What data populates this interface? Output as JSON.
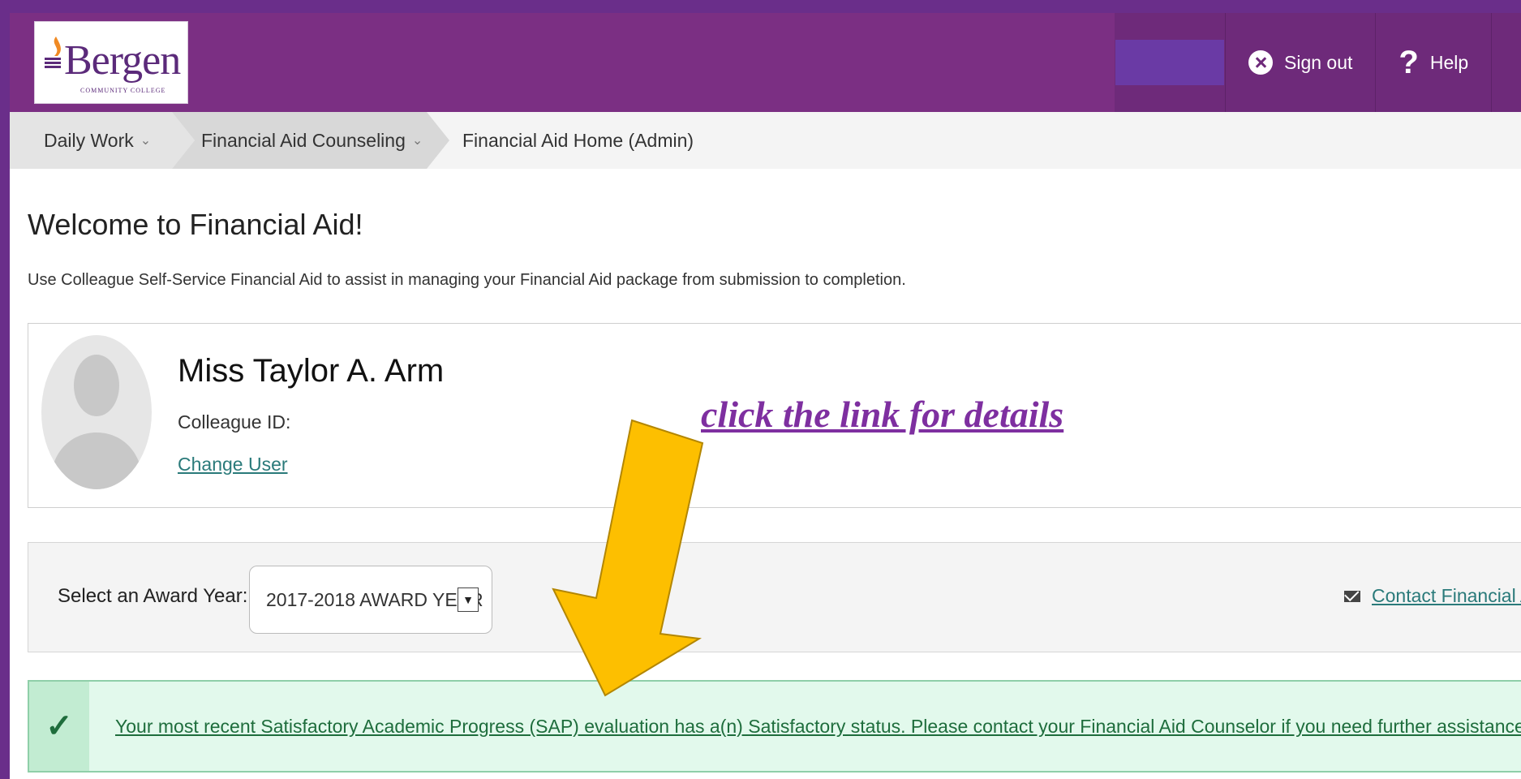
{
  "header": {
    "logo_text": "Bergen",
    "logo_sub": "COMMUNITY COLLEGE",
    "signout_label": "Sign out",
    "help_label": "Help"
  },
  "breadcrumb": {
    "items": [
      "Daily Work",
      "Financial Aid Counseling",
      "Financial Aid Home (Admin)"
    ]
  },
  "main": {
    "title": "Welcome to Financial Aid!",
    "description": "Use Colleague Self-Service Financial Aid to assist in managing your Financial Aid package from submission to completion."
  },
  "profile": {
    "name": "Miss Taylor A. Arm",
    "id_label": "Colleague ID:",
    "change_user": "Change User"
  },
  "annotation": {
    "text": "click the link for details",
    "arrow_color": "#fdbf00"
  },
  "award_year": {
    "label": "Select an Award Year:",
    "selected": "2017-2018 AWARD YEAR",
    "contact_label": "Contact Financial Aid O"
  },
  "sap": {
    "message": "Your most recent Satisfactory Academic Progress (SAP) evaluation has a(n) Satisfactory status. Please contact your Financial Aid Counselor if you need further assistance."
  },
  "colors": {
    "brand": "#7b2f83",
    "link": "#2a7a7a",
    "success": "#1e6d3c"
  }
}
